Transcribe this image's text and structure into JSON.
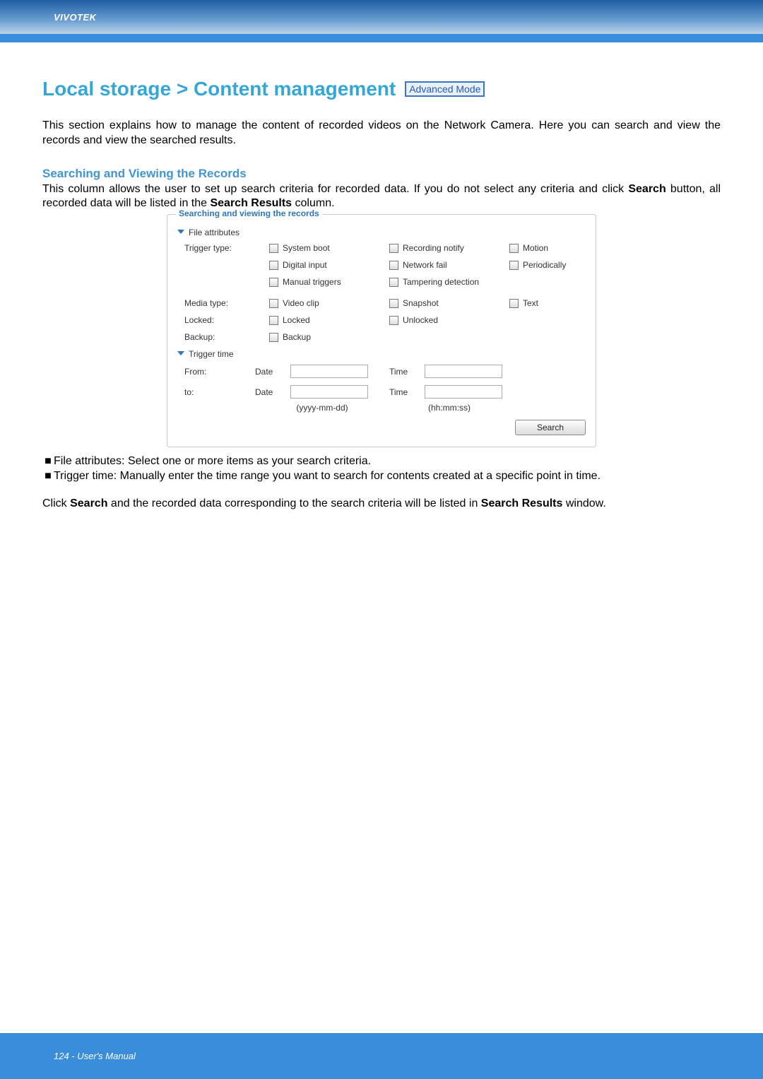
{
  "brand": "VIVOTEK",
  "page_title": "Local storage > Content management",
  "mode_badge": "Advanced Mode",
  "intro": "This section explains how to manage the content of recorded videos on the Network Camera. Here you can search and view the records and view the searched results.",
  "section_heading": "Searching and Viewing the Records",
  "section_intro_1": "This column allows the user to set up search criteria for recorded data. If you do not select any criteria and click ",
  "section_intro_bold_1": "Search",
  "section_intro_2": " button, all recorded data will be listed in the ",
  "section_intro_bold_2": "Search Results",
  "section_intro_3": " column.",
  "panel": {
    "legend": "Searching and viewing the records",
    "file_attr_head": "File attributes",
    "trigger_type_label": "Trigger type:",
    "cb_system_boot": "System boot",
    "cb_recording_notify": "Recording notify",
    "cb_motion": "Motion",
    "cb_digital_input": "Digital input",
    "cb_network_fail": "Network fail",
    "cb_periodically": "Periodically",
    "cb_manual_triggers": "Manual triggers",
    "cb_tampering": "Tampering detection",
    "media_type_label": "Media type:",
    "cb_video_clip": "Video clip",
    "cb_snapshot": "Snapshot",
    "cb_text": "Text",
    "locked_label": "Locked:",
    "cb_locked": "Locked",
    "cb_unlocked": "Unlocked",
    "backup_label": "Backup:",
    "cb_backup": "Backup",
    "trigger_time_head": "Trigger time",
    "from_label": "From:",
    "to_label": "to:",
    "date_label": "Date",
    "time_label": "Time",
    "date_fmt": "(yyyy-mm-dd)",
    "time_fmt": "(hh:mm:ss)",
    "search_btn": "Search"
  },
  "bullet_1_lead": "File attributes: ",
  "bullet_1_rest": "Select one or more items as your search criteria.",
  "bullet_2_lead": "Trigger time: ",
  "bullet_2_rest": "Manually enter the time range you want to search for contents created at a specific point in time.",
  "closing_1": "Click ",
  "closing_bold_1": "Search",
  "closing_2": " and the recorded data corresponding to the search criteria will be listed in ",
  "closing_bold_2": "Search Results",
  "closing_3": " window.",
  "footer": "124 - User's Manual"
}
